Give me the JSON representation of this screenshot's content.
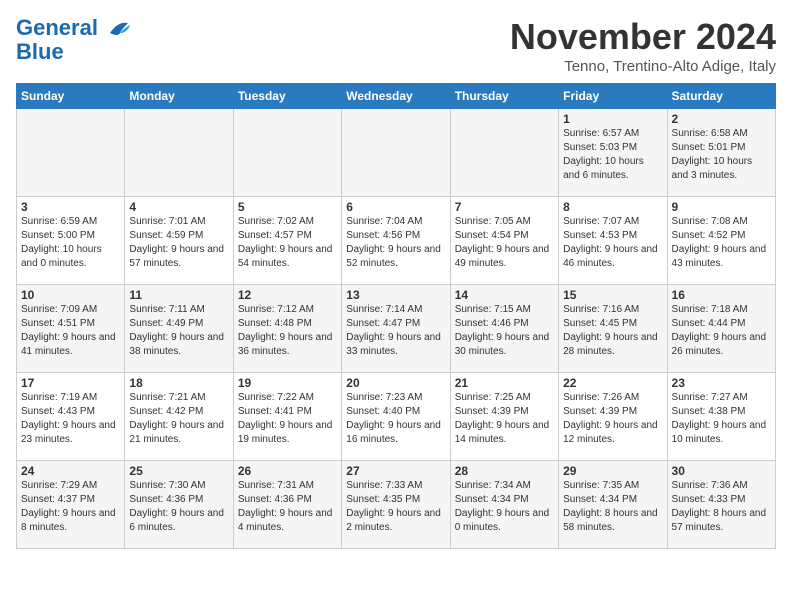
{
  "header": {
    "logo_line1": "General",
    "logo_line2": "Blue",
    "month_title": "November 2024",
    "subtitle": "Tenno, Trentino-Alto Adige, Italy"
  },
  "weekdays": [
    "Sunday",
    "Monday",
    "Tuesday",
    "Wednesday",
    "Thursday",
    "Friday",
    "Saturday"
  ],
  "weeks": [
    [
      {
        "day": "",
        "info": ""
      },
      {
        "day": "",
        "info": ""
      },
      {
        "day": "",
        "info": ""
      },
      {
        "day": "",
        "info": ""
      },
      {
        "day": "",
        "info": ""
      },
      {
        "day": "1",
        "info": "Sunrise: 6:57 AM\nSunset: 5:03 PM\nDaylight: 10 hours\nand 6 minutes."
      },
      {
        "day": "2",
        "info": "Sunrise: 6:58 AM\nSunset: 5:01 PM\nDaylight: 10 hours\nand 3 minutes."
      }
    ],
    [
      {
        "day": "3",
        "info": "Sunrise: 6:59 AM\nSunset: 5:00 PM\nDaylight: 10 hours\nand 0 minutes."
      },
      {
        "day": "4",
        "info": "Sunrise: 7:01 AM\nSunset: 4:59 PM\nDaylight: 9 hours\nand 57 minutes."
      },
      {
        "day": "5",
        "info": "Sunrise: 7:02 AM\nSunset: 4:57 PM\nDaylight: 9 hours\nand 54 minutes."
      },
      {
        "day": "6",
        "info": "Sunrise: 7:04 AM\nSunset: 4:56 PM\nDaylight: 9 hours\nand 52 minutes."
      },
      {
        "day": "7",
        "info": "Sunrise: 7:05 AM\nSunset: 4:54 PM\nDaylight: 9 hours\nand 49 minutes."
      },
      {
        "day": "8",
        "info": "Sunrise: 7:07 AM\nSunset: 4:53 PM\nDaylight: 9 hours\nand 46 minutes."
      },
      {
        "day": "9",
        "info": "Sunrise: 7:08 AM\nSunset: 4:52 PM\nDaylight: 9 hours\nand 43 minutes."
      }
    ],
    [
      {
        "day": "10",
        "info": "Sunrise: 7:09 AM\nSunset: 4:51 PM\nDaylight: 9 hours\nand 41 minutes."
      },
      {
        "day": "11",
        "info": "Sunrise: 7:11 AM\nSunset: 4:49 PM\nDaylight: 9 hours\nand 38 minutes."
      },
      {
        "day": "12",
        "info": "Sunrise: 7:12 AM\nSunset: 4:48 PM\nDaylight: 9 hours\nand 36 minutes."
      },
      {
        "day": "13",
        "info": "Sunrise: 7:14 AM\nSunset: 4:47 PM\nDaylight: 9 hours\nand 33 minutes."
      },
      {
        "day": "14",
        "info": "Sunrise: 7:15 AM\nSunset: 4:46 PM\nDaylight: 9 hours\nand 30 minutes."
      },
      {
        "day": "15",
        "info": "Sunrise: 7:16 AM\nSunset: 4:45 PM\nDaylight: 9 hours\nand 28 minutes."
      },
      {
        "day": "16",
        "info": "Sunrise: 7:18 AM\nSunset: 4:44 PM\nDaylight: 9 hours\nand 26 minutes."
      }
    ],
    [
      {
        "day": "17",
        "info": "Sunrise: 7:19 AM\nSunset: 4:43 PM\nDaylight: 9 hours\nand 23 minutes."
      },
      {
        "day": "18",
        "info": "Sunrise: 7:21 AM\nSunset: 4:42 PM\nDaylight: 9 hours\nand 21 minutes."
      },
      {
        "day": "19",
        "info": "Sunrise: 7:22 AM\nSunset: 4:41 PM\nDaylight: 9 hours\nand 19 minutes."
      },
      {
        "day": "20",
        "info": "Sunrise: 7:23 AM\nSunset: 4:40 PM\nDaylight: 9 hours\nand 16 minutes."
      },
      {
        "day": "21",
        "info": "Sunrise: 7:25 AM\nSunset: 4:39 PM\nDaylight: 9 hours\nand 14 minutes."
      },
      {
        "day": "22",
        "info": "Sunrise: 7:26 AM\nSunset: 4:39 PM\nDaylight: 9 hours\nand 12 minutes."
      },
      {
        "day": "23",
        "info": "Sunrise: 7:27 AM\nSunset: 4:38 PM\nDaylight: 9 hours\nand 10 minutes."
      }
    ],
    [
      {
        "day": "24",
        "info": "Sunrise: 7:29 AM\nSunset: 4:37 PM\nDaylight: 9 hours\nand 8 minutes."
      },
      {
        "day": "25",
        "info": "Sunrise: 7:30 AM\nSunset: 4:36 PM\nDaylight: 9 hours\nand 6 minutes."
      },
      {
        "day": "26",
        "info": "Sunrise: 7:31 AM\nSunset: 4:36 PM\nDaylight: 9 hours\nand 4 minutes."
      },
      {
        "day": "27",
        "info": "Sunrise: 7:33 AM\nSunset: 4:35 PM\nDaylight: 9 hours\nand 2 minutes."
      },
      {
        "day": "28",
        "info": "Sunrise: 7:34 AM\nSunset: 4:34 PM\nDaylight: 9 hours\nand 0 minutes."
      },
      {
        "day": "29",
        "info": "Sunrise: 7:35 AM\nSunset: 4:34 PM\nDaylight: 8 hours\nand 58 minutes."
      },
      {
        "day": "30",
        "info": "Sunrise: 7:36 AM\nSunset: 4:33 PM\nDaylight: 8 hours\nand 57 minutes."
      }
    ]
  ]
}
